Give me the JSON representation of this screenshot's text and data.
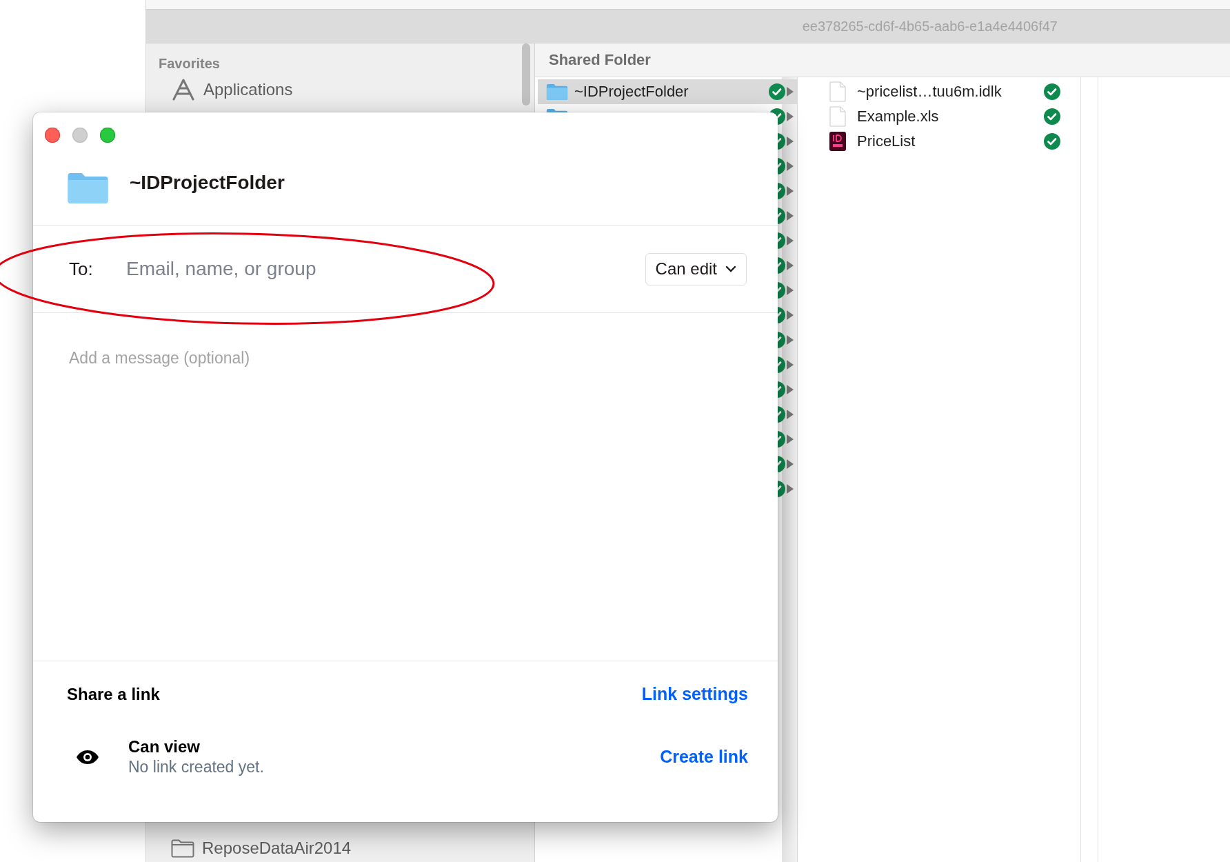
{
  "finder": {
    "title": "ee378265-cd6f-4b65-aab6-e1a4e4406f47",
    "sidebar": {
      "heading": "Favorites",
      "items": [
        {
          "label": "Applications",
          "kind": "apps"
        }
      ],
      "bottom_items": [
        {
          "label": "ReposeDataAir2014",
          "kind": "folder"
        }
      ]
    },
    "column_header": "Shared Folder",
    "folders": [
      {
        "name": "~IDProjectFolder",
        "selected": true,
        "synced": true
      },
      {
        "selected": false,
        "synced": true
      },
      {
        "selected": false,
        "synced": true
      },
      {
        "selected": false,
        "synced": true
      },
      {
        "selected": false,
        "synced": true
      },
      {
        "selected": false,
        "synced": true
      },
      {
        "selected": false,
        "synced": true
      },
      {
        "selected": false,
        "synced": true
      },
      {
        "selected": false,
        "synced": true
      },
      {
        "selected": false,
        "synced": true
      },
      {
        "selected": false,
        "synced": true
      },
      {
        "selected": false,
        "synced": true
      },
      {
        "selected": false,
        "synced": true
      },
      {
        "selected": false,
        "synced": true
      },
      {
        "selected": false,
        "synced": true
      },
      {
        "selected": false,
        "synced": true
      },
      {
        "selected": false,
        "synced": true
      }
    ],
    "files": [
      {
        "name": "~pricelist…tuu6m.idlk",
        "kind": "doc",
        "synced": true
      },
      {
        "name": "Example.xls",
        "kind": "doc",
        "synced": true
      },
      {
        "name": "PriceList",
        "kind": "indd",
        "synced": true
      }
    ]
  },
  "dialog": {
    "title": "~IDProjectFolder",
    "to_label": "To:",
    "to_placeholder": "Email, name, or group",
    "permission": "Can edit",
    "message_placeholder": "Add a message (optional)",
    "link_heading": "Share a link",
    "link_settings": "Link settings",
    "link_access": "Can view",
    "link_status": "No link created yet.",
    "create_link": "Create link"
  },
  "annotation": {
    "kind": "ellipse"
  }
}
